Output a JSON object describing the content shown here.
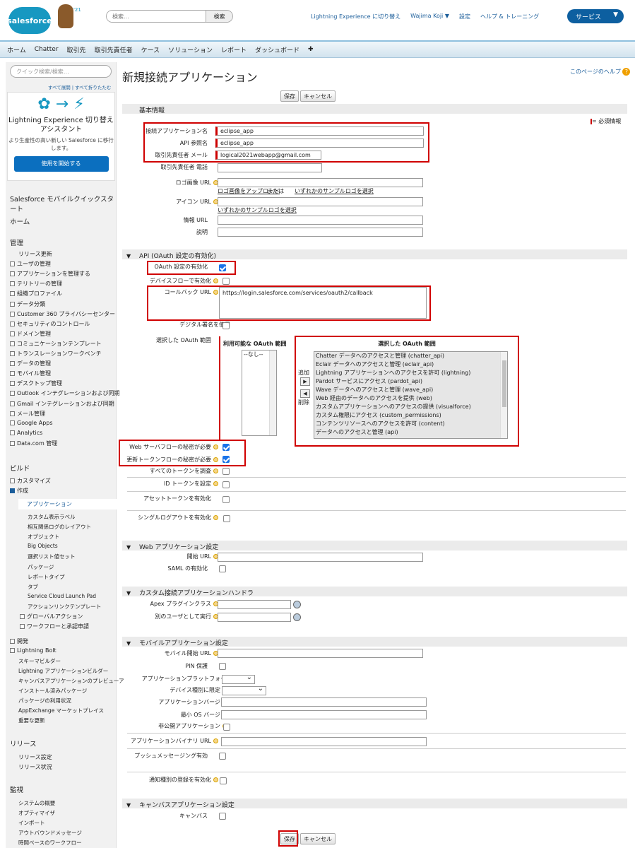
{
  "header": {
    "logo": "salesforce",
    "version": "'21",
    "search_placeholder": "検索...",
    "search_button": "検索",
    "links": [
      "Lightning Experience に切り替え",
      "Wajima Koji ▼",
      "設定",
      "ヘルプ & トレーニング"
    ],
    "service": "サービス"
  },
  "nav": {
    "tabs": [
      "ホーム",
      "Chatter",
      "取引先",
      "取引先責任者",
      "ケース",
      "ソリューション",
      "レポート",
      "ダッシュボード",
      "✚"
    ]
  },
  "sidebar": {
    "quick_search": "クイック検索/検索…",
    "expand_collapse": "すべて展開 | すべて折りたたむ",
    "lex": {
      "title": "Lightning Experience 切り替えアシスタント",
      "desc": "より生産性の高い新しい Salesforce に移行します。",
      "button": "使用を開始する"
    },
    "mobile": "Salesforce モバイルクイックスタート",
    "home": "ホーム",
    "admin_head": "管理",
    "admin_items": [
      "リリース更新",
      "ユーザの管理",
      "アプリケーションを管理する",
      "テリトリーの管理",
      "組織プロファイル",
      "データ分類",
      "Customer 360 プライバシーセンター",
      "セキュリティのコントロール",
      "ドメイン管理",
      "コミュニケーションテンプレート",
      "トランスレーションワークベンチ",
      "データの管理",
      "モバイル管理",
      "デスクトップ管理",
      "Outlook インテグレーションおよび同期",
      "Gmail インテグレーションおよび同期",
      "メール管理",
      "Google Apps",
      "Analytics",
      "Data.com 管理"
    ],
    "build_head": "ビルド",
    "build_items": [
      "カスタマイズ",
      "作成"
    ],
    "create_items": [
      "アプリケーション",
      "カスタム表示ラベル",
      "相互関係ログのレイアウト",
      "オブジェクト",
      "Big Objects",
      "選択リスト値セット",
      "パッケージ",
      "レポートタイプ",
      "タブ",
      "Service Cloud Launch Pad",
      "アクションリンクテンプレート"
    ],
    "create_sub": [
      "グローバルアクション",
      "ワークフローと承認申請"
    ],
    "dev_items": [
      "開発",
      "Lightning Bolt",
      "スキーマビルダー",
      "Lightning アプリケーションビルダー",
      "キャンバスアプリケーションのプレビューア",
      "インストール済みパッケージ",
      "パッケージの利用状況",
      "AppExchange マーケットプレイス",
      "重要な更新"
    ],
    "release_head": "リリース",
    "release_items": [
      "リリース設定",
      "リリース状況"
    ],
    "monitor_head": "監視",
    "monitor_items": [
      "システムの概要",
      "オプティマイザ",
      "インポート",
      "アウトバウンドメッセージ",
      "時間ベースのワークフロー"
    ]
  },
  "main": {
    "title": "新規接続アプリケーション",
    "help": "このページのヘルプ",
    "save": "保存",
    "cancel": "キャンセル",
    "required": "= 必須情報",
    "basic_section": "基本情報",
    "labels": {
      "app_name": "接続アプリケーション名",
      "api_name": "API 参照名",
      "contact_email": "取引先責任者 メール",
      "contact_phone": "取引先責任者 電話",
      "logo_url": "ロゴ画像 URL",
      "icon_url": "アイコン URL",
      "info_url": "情報 URL",
      "description": "説明"
    },
    "values": {
      "app_name": "eclipse_app",
      "api_name": "eclipse_app",
      "contact_email": "logical2021webapp@gmail.com"
    },
    "logo_link1": "ロゴ画像をアップロード",
    "logo_or": "または",
    "logo_link2": "いずれかのサンプルロゴを選択",
    "icon_link": "いずれかのサンプルロゴを選択",
    "api_section": "API (OAuth 設定の有効化)",
    "oauth_enable": "OAuth 設定の有効化",
    "device_flow": "デバイスフローで有効化",
    "callback_url": "コールバック URL",
    "callback_value": "https://login.salesforce.com/services/oauth2/callback",
    "digital_sig": "デジタル署名を使用",
    "selected_scopes_label": "選択した OAuth 範囲",
    "available_head": "利用可能な OAuth 範囲",
    "available_items": [
      "--なし--"
    ],
    "add": "追加",
    "remove": "削除",
    "selected_head": "選択した OAuth 範囲",
    "selected_items": [
      "Chatter データへのアクセスと管理 (chatter_api)",
      "Eclair データへのアクセスと管理 (eclair_api)",
      "Lightning アプリケーションへのアクセスを許可 (lightning)",
      "Pardot サービスにアクセス (pardot_api)",
      "Wave データへのアクセスと管理 (wave_api)",
      "Web 経由のデータへのアクセスを提供 (web)",
      "カスタムアプリケーションへのアクセスの提供 (visualforce)",
      "カスタム権限にアクセス (custom_permissions)",
      "コンテンツリソースへのアクセスを許可 (content)",
      "データへのアクセスと管理 (api)"
    ],
    "web_secret": "Web サーバフローの秘密が必要",
    "refresh_secret": "更新トークンフローの秘密が必要",
    "introspect": "すべてのトークンを調査",
    "id_token": "ID トークンを設定",
    "asset_token": "アセットトークンを有効化",
    "single_logout": "シングルログアウトを有効化",
    "web_section": "Web アプリケーション設定",
    "start_url": "開始 URL",
    "saml": "SAML の有効化",
    "handler_section": "カスタム接続アプリケーションハンドラ",
    "apex_plugin": "Apex プラグインクラス",
    "run_as": "別のユーザとして実行",
    "mobile_section": "モバイルアプリケーション設定",
    "mobile_start": "モバイル開始 URL",
    "pin": "PIN 保護",
    "platform": "アプリケーションプラットフォーム",
    "device_limit": "デバイス種別に限定",
    "app_version": "アプリケーションバージョン",
    "min_os": "最小 OS バージョン",
    "private_app": "非公開アプリケーション",
    "binary_url": "アプリケーションバイナリ URL",
    "push": "プッシュメッセージング有効",
    "notif": "通知種別の登録を有効化",
    "canvas_section": "キャンバスアプリケーション設定",
    "canvas": "キャンバス"
  }
}
